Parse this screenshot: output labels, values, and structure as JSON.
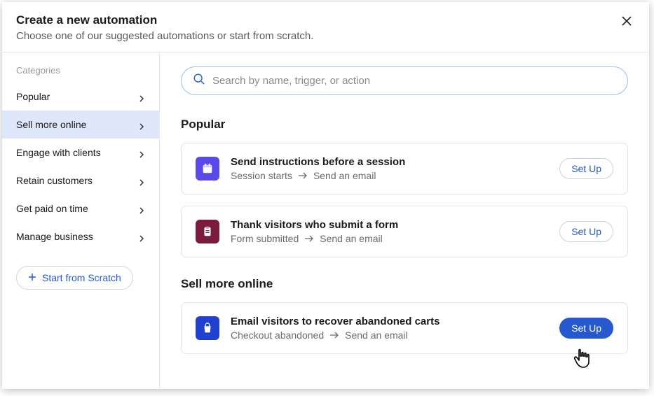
{
  "header": {
    "title": "Create a new automation",
    "subtitle": "Choose one of our suggested automations or start from scratch."
  },
  "sidebar": {
    "label": "Categories",
    "items": [
      {
        "label": "Popular"
      },
      {
        "label": "Sell more online"
      },
      {
        "label": "Engage with clients"
      },
      {
        "label": "Retain customers"
      },
      {
        "label": "Get paid on time"
      },
      {
        "label": "Manage business"
      }
    ],
    "scratch_label": "Start from Scratch"
  },
  "search": {
    "placeholder": "Search by name, trigger, or action"
  },
  "sections": [
    {
      "title": "Popular",
      "cards": [
        {
          "title": "Send instructions before a session",
          "trigger": "Session starts",
          "action": "Send an email",
          "button": "Set Up",
          "icon": "calendar-icon",
          "icon_color": "purple"
        },
        {
          "title": "Thank visitors who submit a form",
          "trigger": "Form submitted",
          "action": "Send an email",
          "button": "Set Up",
          "icon": "clipboard-icon",
          "icon_color": "maroon"
        }
      ]
    },
    {
      "title": "Sell more online",
      "cards": [
        {
          "title": "Email visitors to recover abandoned carts",
          "trigger": "Checkout abandoned",
          "action": "Send an email",
          "button": "Set Up",
          "icon": "bag-icon",
          "icon_color": "blue",
          "primary": true
        }
      ]
    }
  ]
}
